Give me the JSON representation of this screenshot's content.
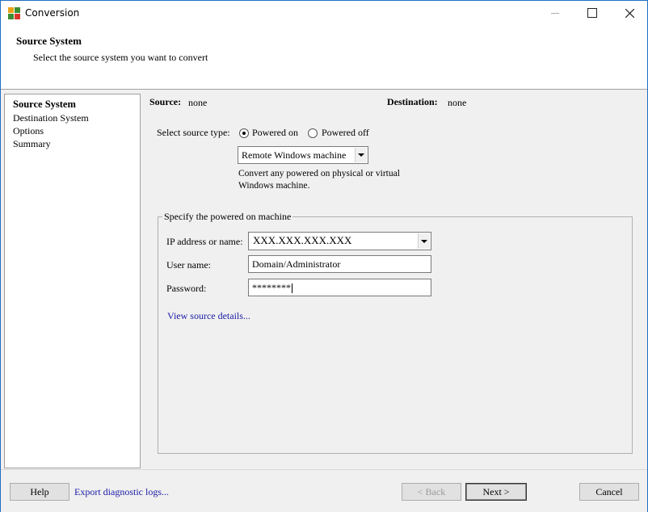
{
  "window": {
    "title": "Conversion"
  },
  "header": {
    "title": "Source System",
    "subtitle": "Select the source system you want to convert"
  },
  "nav": {
    "items": [
      "Source System",
      "Destination System",
      "Options",
      "Summary"
    ]
  },
  "summary": {
    "source_label": "Source:",
    "source_value": "none",
    "destination_label": "Destination:",
    "destination_value": "none"
  },
  "source_type": {
    "label": "Select source type:",
    "options": [
      "Powered on",
      "Powered off"
    ],
    "selected": "Powered on",
    "machine_type": "Remote Windows machine",
    "description_line1": "Convert any powered on physical or virtual",
    "description_line2": "Windows machine."
  },
  "machine": {
    "legend": "Specify the powered on machine",
    "ip_label": "IP address or name:",
    "ip_value": "XXX.XXX.XXX.XXX",
    "user_label": "User name:",
    "user_value": "Domain/Administrator",
    "password_label": "Password:",
    "password_value": "********",
    "details_link": "View source details..."
  },
  "footer": {
    "help": "Help",
    "export_logs": "Export diagnostic logs...",
    "back": "< Back",
    "next": "Next >",
    "cancel": "Cancel"
  },
  "colors": {
    "link": "#1a1aa6",
    "panel_bg": "#f0f0f0",
    "window_border": "#1e6fc4"
  }
}
